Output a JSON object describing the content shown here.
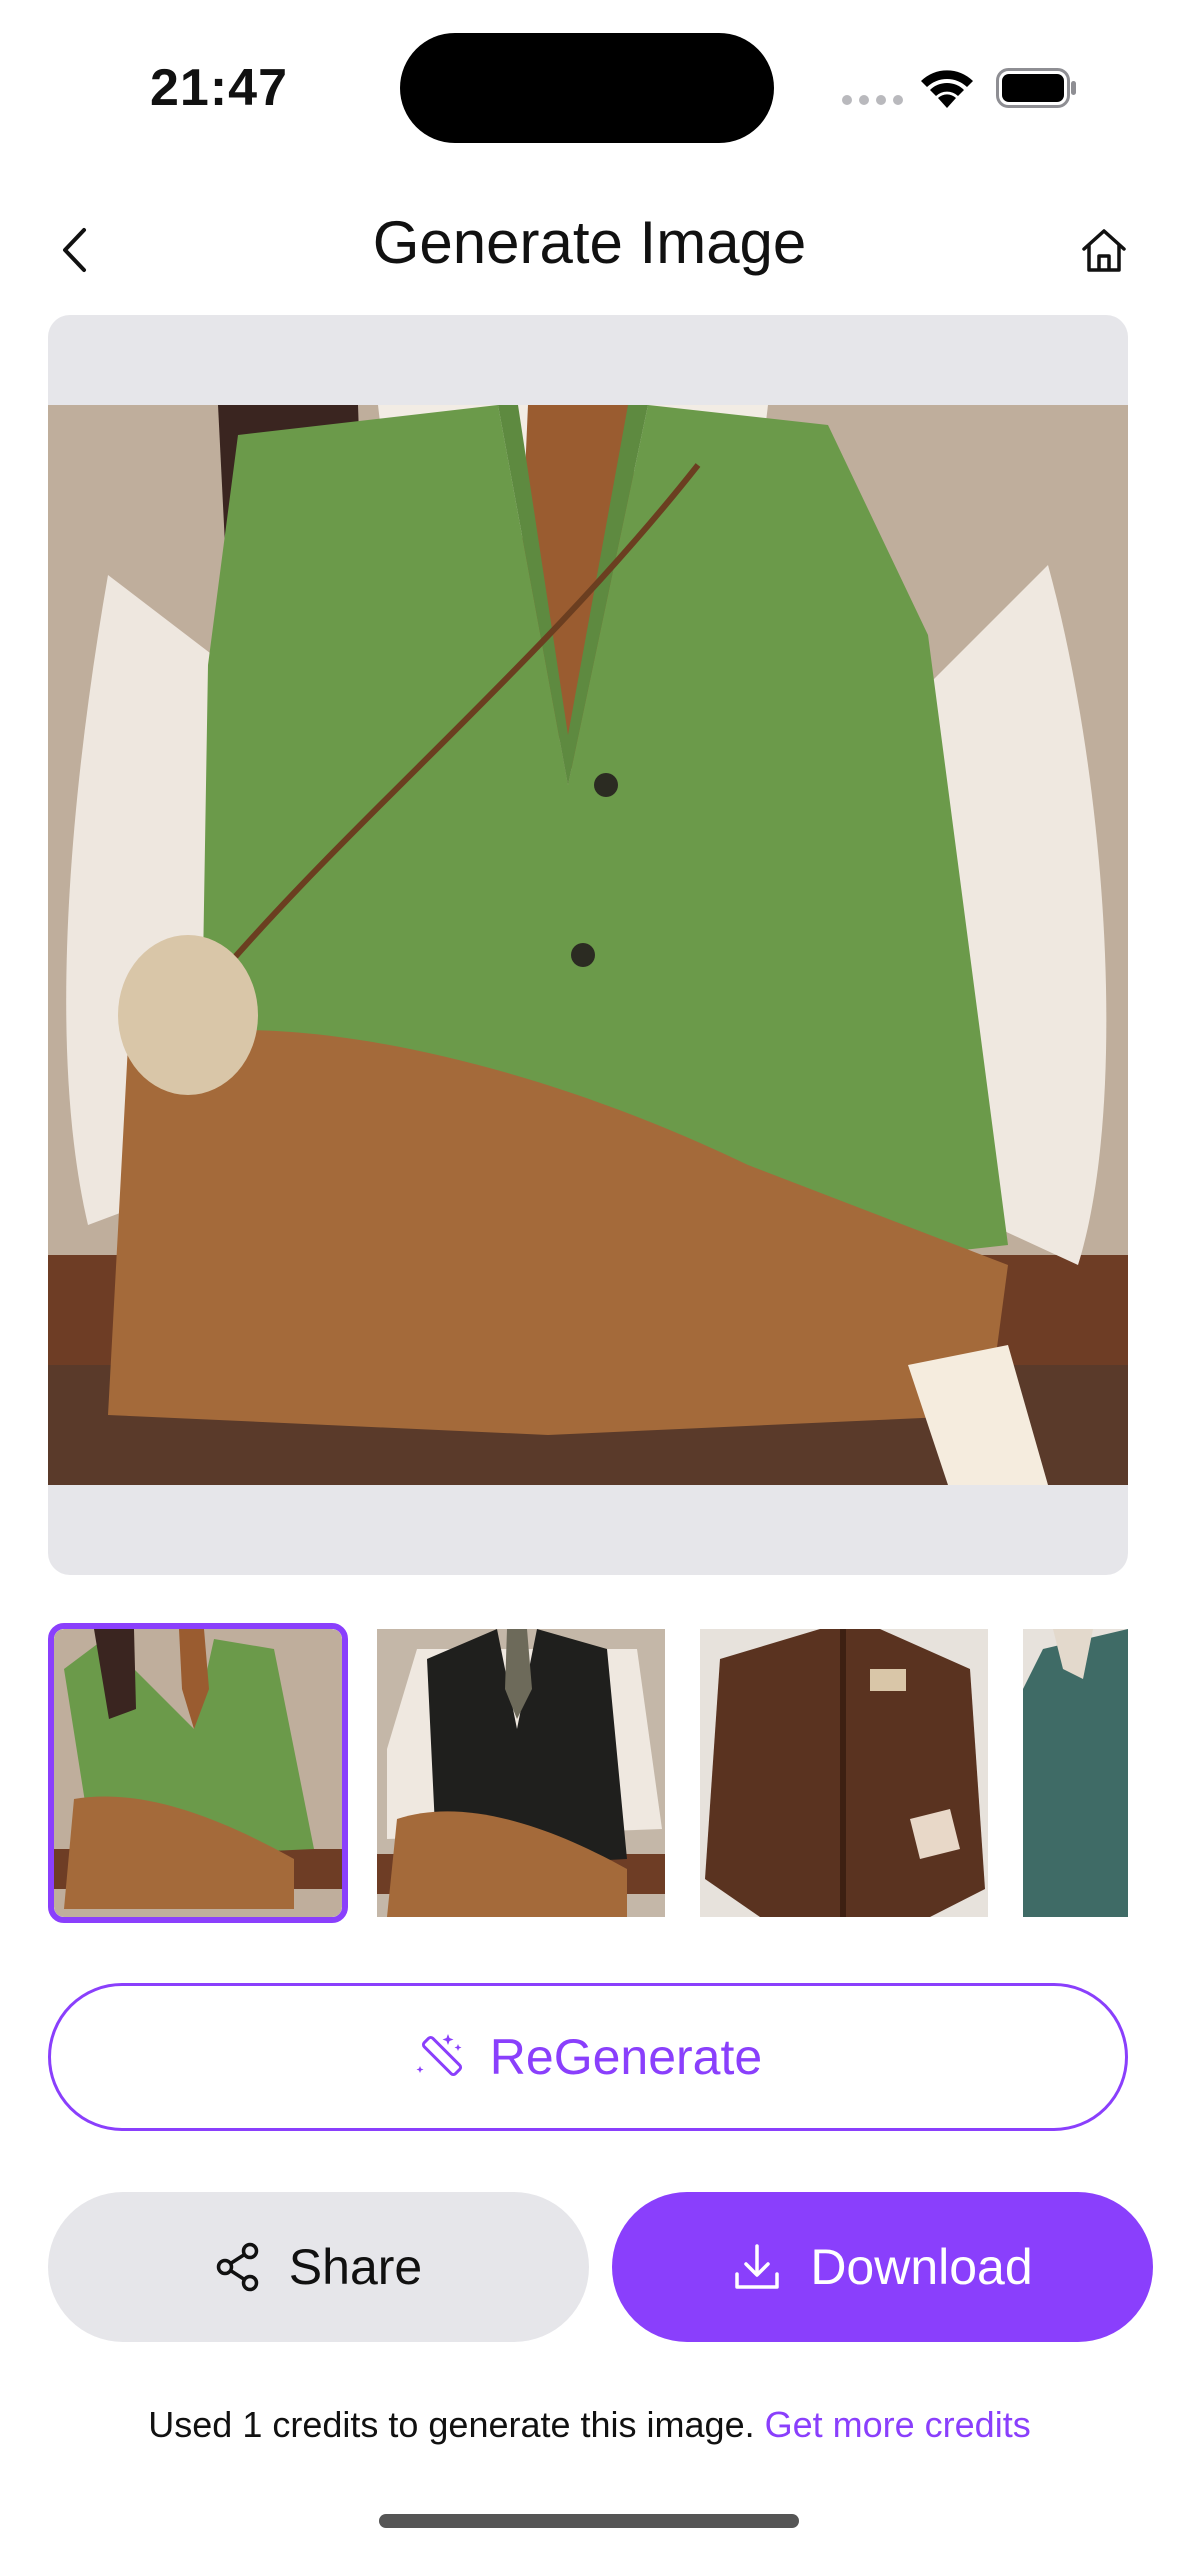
{
  "status_bar": {
    "time": "21:47"
  },
  "header": {
    "title": "Generate Image",
    "back_icon": "chevron-left-icon",
    "home_icon": "home-icon"
  },
  "preview": {
    "selected_index": 0
  },
  "thumbnails": [
    {
      "label": "green knit vest outfit",
      "selected": true
    },
    {
      "label": "black knit vest outfit",
      "selected": false
    },
    {
      "label": "brown corduroy jacket outfit",
      "selected": false
    },
    {
      "label": "teal jacket outfit",
      "selected": false
    }
  ],
  "actions": {
    "regenerate_label": "ReGenerate",
    "share_label": "Share",
    "download_label": "Download"
  },
  "footer": {
    "usage_text": "Used 1 credits to generate this image.",
    "link_text": "Get more credits"
  },
  "colors": {
    "accent": "#8a3ffc",
    "secondary_button": "#e6e6ea"
  }
}
